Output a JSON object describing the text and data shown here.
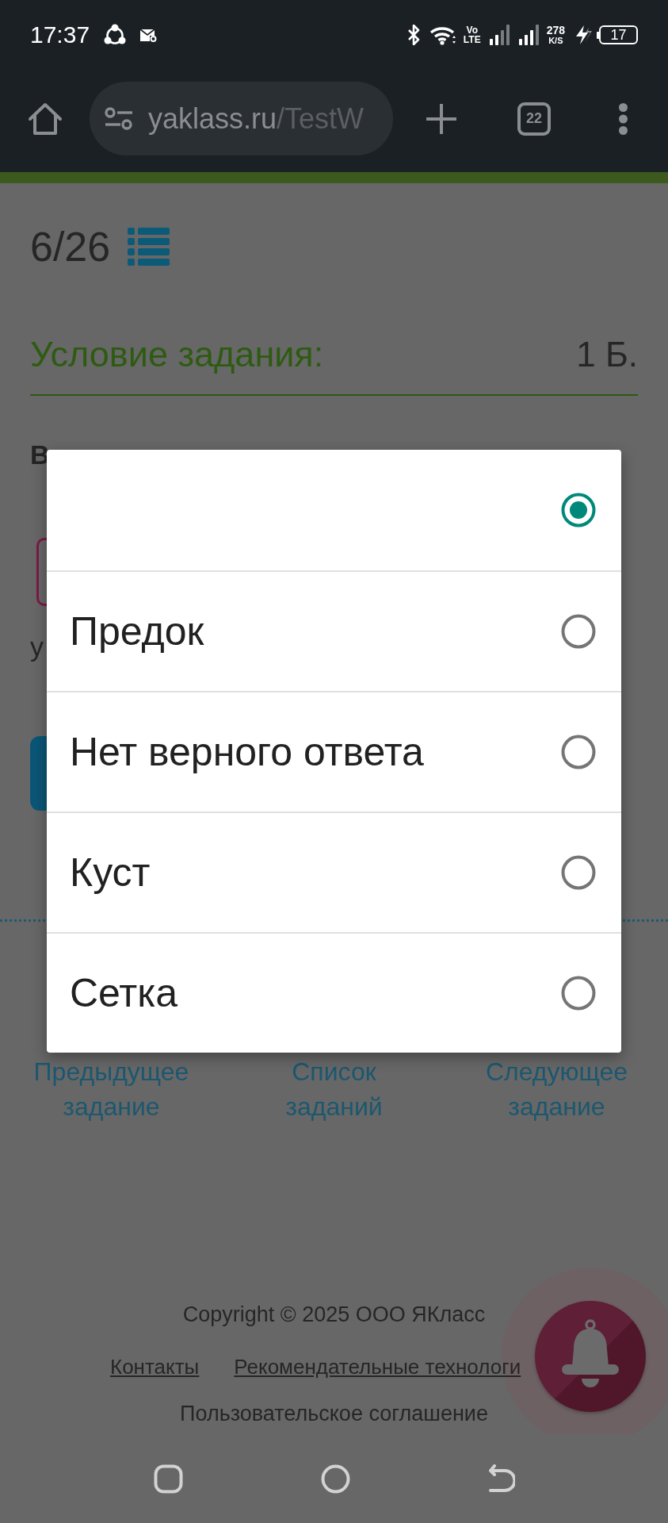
{
  "status_bar": {
    "time": "17:37",
    "network_type": [
      "Vo",
      "LTE"
    ],
    "speed": "278",
    "speed_unit": "K/S",
    "battery": "17"
  },
  "browser_toolbar": {
    "url_host": "yaklass.ru",
    "url_path": "/TestW",
    "tab_count": "22"
  },
  "task_header": {
    "counter": "6/26"
  },
  "task_condition": {
    "title": "Условие задания:",
    "points": "1 Б."
  },
  "question": {
    "instruction": "В",
    "text_fragment": "у"
  },
  "task_nav": [
    "Предыдущее задание",
    "Список заданий",
    "Следующее задание"
  ],
  "footer": {
    "copyright": "Copyright © 2025 ООО ЯКласс",
    "links": [
      "Контакты",
      "Рекомендательные технологи"
    ],
    "agreement": "Пользовательское соглашение"
  },
  "dialog": {
    "options": [
      {
        "selected": true
      },
      {
        "label": "Предок",
        "selected": false
      },
      {
        "label": "Нет верного ответа",
        "selected": false
      },
      {
        "label": "Куст",
        "selected": false
      },
      {
        "label": "Сетка",
        "selected": false
      }
    ]
  }
}
